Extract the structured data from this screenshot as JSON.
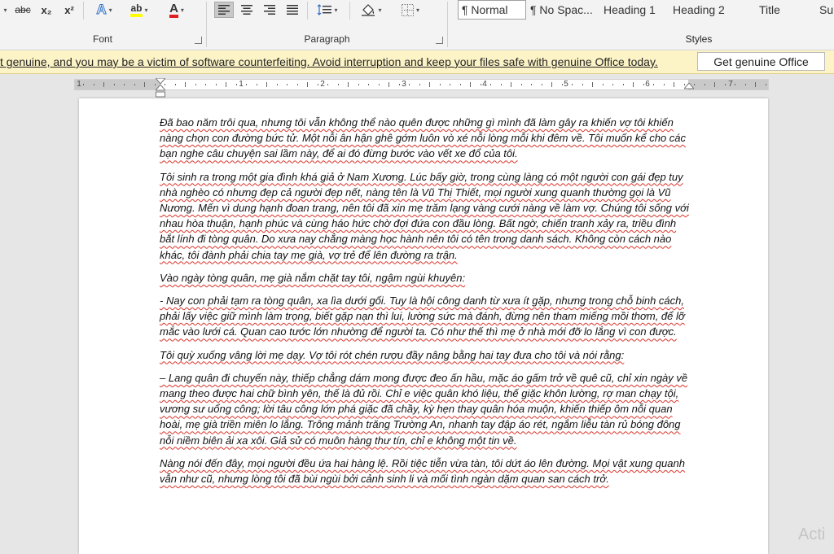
{
  "ribbon": {
    "font_group": {
      "label": "Font",
      "strikethrough": "abc",
      "subscript": "x₂",
      "superscript": "x²",
      "text_effects": "A",
      "highlight": "ab",
      "font_color": "A"
    },
    "paragraph_group": {
      "label": "Paragraph"
    },
    "styles_group": {
      "label": "Styles",
      "items": [
        "¶ Normal",
        "¶ No Spac...",
        "Heading 1",
        "Heading 2",
        "Title",
        "Sul"
      ]
    }
  },
  "notification": {
    "message": "t genuine, and you may be a victim of software counterfeiting. Avoid interruption and keep your files safe with genuine Office today.",
    "button_label": "Get genuine Office"
  },
  "ruler": {
    "numbers": [
      "1",
      "1",
      "2",
      "3",
      "4",
      "5",
      "6",
      "7"
    ]
  },
  "document": {
    "paragraphs": [
      "Đã bao năm trôi qua, nhưng tôi vẫn không thể nào quên được những gì mình đã làm gây ra khiến vợ tôi khiến nàng chọn con đường bức tử. Một nỗi ân hận ghê gớm luôn vò xé nỗi lòng mỗi khi đêm về. Tôi muốn kể cho các bạn nghe câu chuyện sai lầm này, để ai đó đừng bước vào vết xe đổ của tôi.",
      "Tôi sinh ra trong một gia đình khá giả ở Nam Xương. Lúc bấy giờ, trong cùng làng có một người con gái đẹp tuy nhà nghèo có nhưng đẹp cả người đẹp nết, nàng tên là Vũ Thị Thiết, mọi người xung quanh thường gọi là Vũ Nương. Mến vì dung hạnh đoan trang, nên tôi đã xin mẹ trăm lạng vàng cưới nàng về làm vợ. Chúng tôi sống với nhau hòa thuận, hạnh phúc và cùng háo hức chờ đợi đứa con đầu lòng. Bất ngờ, chiến tranh xảy ra, triều đình bắt lính đi tòng quân. Do xưa nay chẳng màng học hành nên tôi có tên trong danh sách. Không còn cách nào khác, tôi đành phải chia tay mẹ già, vợ trẻ để lên đường ra trận.",
      "Vào ngày tòng quân, mẹ già nắm chặt tay tôi, ngậm ngùi khuyên:",
      "- Nay con phải tạm ra tòng quân, xa lìa dưới gối. Tuy là hội công danh từ xưa ít gặp, nhưng trong chỗ binh cách, phải lấy việc giữ mình làm trọng, biết gặp nạn thì lui, lường sức mà đánh, đừng nên tham miếng mồi thơm, để lỡ mắc vào lưới cá. Quan cao tước lớn nhường để người ta. Có như thế thì mẹ ở nhà mới đỡ lo lắng vì con được.",
      "Tôi quỳ xuống vâng lời mẹ dạy. Vợ tôi rót chén rượu đầy nâng bằng hai tay đưa cho tôi và nói rằng:",
      "– Lang quân đi chuyến này, thiếp chẳng dám mong được đeo ấn hầu, mặc áo gấm trở về quê cũ, chỉ xin ngày về mang theo được hai chữ bình yên, thế là đủ rồi. Chỉ e việc quân khó liệu, thế giặc khôn lường, rợ man chạy tội, vương sư uổng công; lời tâu công lớn phá giặc đã chầy, kỳ hẹn thay quân hóa muộn, khiến thiếp ôm nỗi quan hoài, mẹ già triền miên lo lắng. Trông mảnh trăng Trường An, nhanh tay đập áo rét, ngắm liễu tàn rủ bóng đông nỗi niềm biên ải xa xôi. Giả sử có muôn hàng thư tín, chỉ e không một tin về.",
      "Nàng nói đến đây, mọi người đều ứa hai hàng lệ. Rồi tiệc tiễn vừa tàn, tôi dứt áo lên đường. Mọi vật xung quanh vẫn như cũ, nhưng lòng tôi đã bùi ngùi bởi cảnh sinh li và mối tình ngàn dặm quan san cách trở."
    ]
  },
  "watermark": {
    "text": "Acti"
  }
}
